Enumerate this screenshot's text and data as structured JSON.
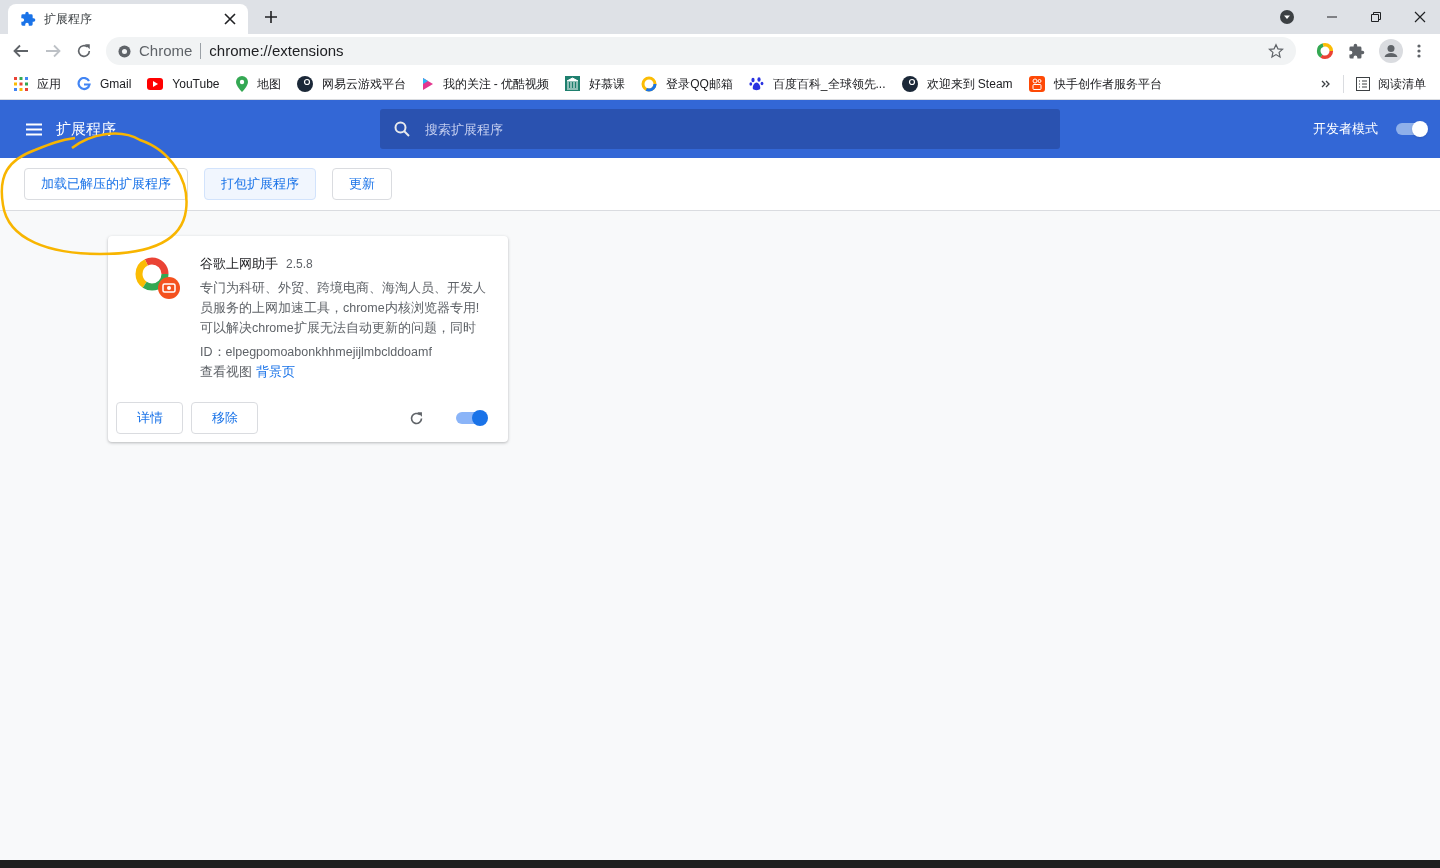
{
  "browser_tab": {
    "title": "扩展程序",
    "selected": true
  },
  "address_bar": {
    "site_label": "Chrome",
    "url": "chrome://extensions"
  },
  "bookmarks": [
    {
      "kind": "apps",
      "label": "应用"
    },
    {
      "kind": "google",
      "label": "Gmail"
    },
    {
      "kind": "youtube",
      "label": "YouTube"
    },
    {
      "kind": "pin",
      "label": "地图"
    },
    {
      "kind": "dark",
      "label": "网易云游戏平台"
    },
    {
      "kind": "play",
      "label": "我的关注 - 优酷视频"
    },
    {
      "kind": "green",
      "label": "好慕课"
    },
    {
      "kind": "ring",
      "label": "登录QQ邮箱"
    },
    {
      "kind": "paw",
      "label": "百度百科_全球领先..."
    },
    {
      "kind": "dark",
      "label": "欢迎来到 Steam"
    },
    {
      "kind": "orange",
      "label": "快手创作者服务平台"
    }
  ],
  "reading_list": "阅读清单",
  "header": {
    "title": "扩展程序",
    "search_placeholder": "搜索扩展程序",
    "dev_mode_label": "开发者模式",
    "dev_mode_on": true
  },
  "dev_buttons": [
    "加载已解压的扩展程序",
    "打包扩展程序",
    "更新"
  ],
  "extensions": [
    {
      "name": "谷歌上网助手",
      "version": "2.5.8",
      "description": "专门为科研、外贸、跨境电商、海淘人员、开发人员服务的上网加速工具，chrome内核浏览器专用!可以解决chrome扩展无法自动更新的问题，同时",
      "id": "ID：elpegpomoabonkhhmejijlmbclddoamf",
      "views_label": "查看视图",
      "views_link": "背景页",
      "details_button": "详情",
      "remove_button": "移除",
      "enabled": true
    }
  ]
}
